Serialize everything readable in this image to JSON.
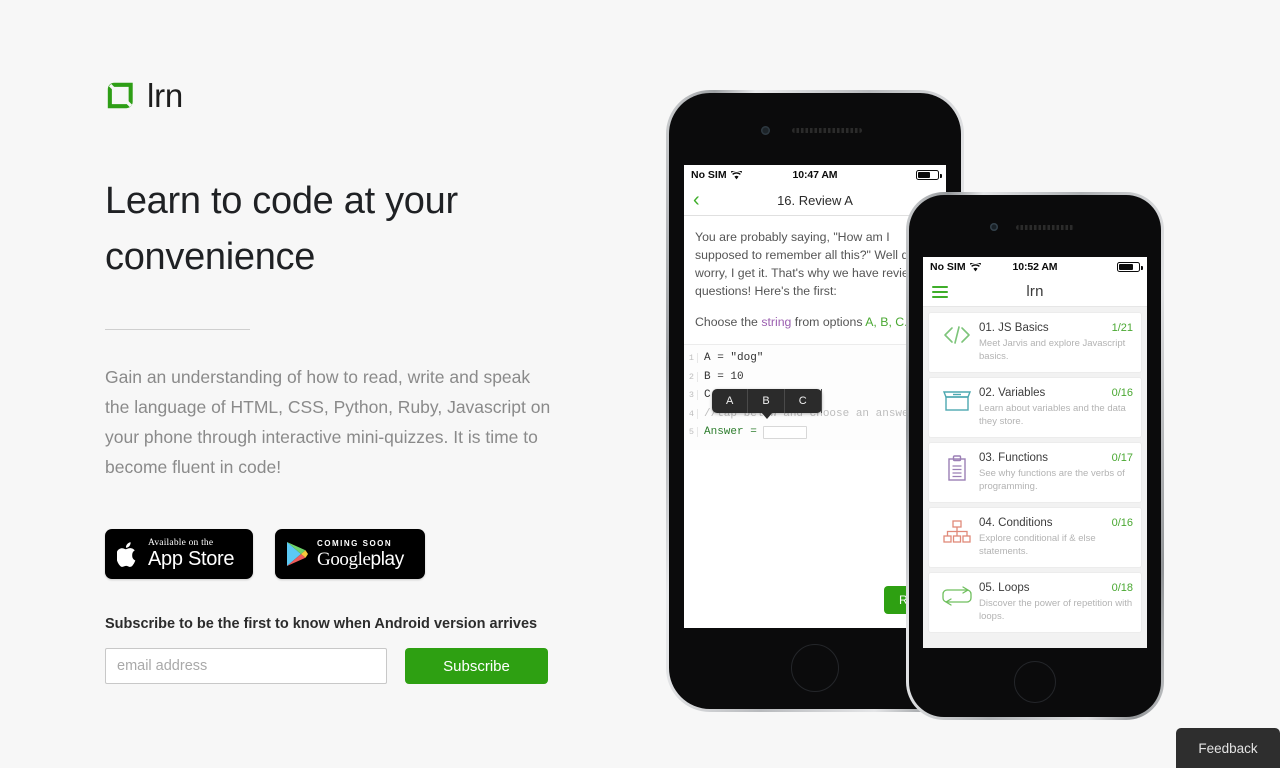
{
  "brand": {
    "name": "lrn",
    "logo_color": "#2e9e16"
  },
  "hero": {
    "headline": "Learn to code at your convenience",
    "lede": "Gain an understanding of how to read, write and speak the language of HTML, CSS, Python, Ruby, Javascript on your phone through interactive mini-quizzes. It is time to become fluent in code!"
  },
  "badges": {
    "apple": {
      "small": "Available on the",
      "big": "App Store"
    },
    "google": {
      "top": "COMING SOON",
      "main_bold": "Google",
      "main_light": "play"
    }
  },
  "subscribe": {
    "label": "Subscribe to be the first to know when Android version arrives",
    "email_placeholder": "email address",
    "email_value": "",
    "button_label": "Subscribe"
  },
  "accent_color": "#2ea012",
  "feedback": {
    "label": "Feedback"
  },
  "phone_lesson": {
    "status": {
      "carrier": "No SIM",
      "time": "10:47 AM"
    },
    "nav": {
      "title": "16. Review A",
      "back_glyph": "‹"
    },
    "paragraph1": "You are probably saying, \"How am I supposed to remember all this?\" Well don't worry, I get it. That's why we have review questions! Here's the first:",
    "paragraph2": {
      "pre": "Choose the ",
      "keyword": "string",
      "mid": " from options ",
      "options": "A, B, C."
    },
    "code": [
      {
        "num": "1",
        "text": "A = \"dog\""
      },
      {
        "num": "2",
        "text": "B = 10"
      },
      {
        "num": "3",
        "text": "C = [1, 2]"
      },
      {
        "num": "4",
        "text": "//tap below and choose an answer"
      },
      {
        "num": "5",
        "text": "Answer = "
      }
    ],
    "tooltip_options": [
      "A",
      "B",
      "C"
    ],
    "run_button": "Run"
  },
  "phone_courses": {
    "status": {
      "carrier": "No SIM",
      "time": "10:52 AM"
    },
    "nav": {
      "title": "lrn"
    },
    "items": [
      {
        "title": "01. JS Basics",
        "count": "1/21",
        "desc": "Meet Jarvis and explore Javascript basics.",
        "icon": "code-brackets-icon",
        "icon_color": "#7dc47a"
      },
      {
        "title": "02. Variables",
        "count": "0/16",
        "desc": "Learn about variables and the data they store.",
        "icon": "box-icon",
        "icon_color": "#4da8b0"
      },
      {
        "title": "03. Functions",
        "count": "0/17",
        "desc": "See why functions are the verbs of programming.",
        "icon": "clipboard-icon",
        "icon_color": "#9b7fb5"
      },
      {
        "title": "04. Conditions",
        "count": "0/16",
        "desc": "Explore conditional if & else statements.",
        "icon": "tree-hierarchy-icon",
        "icon_color": "#e08a7a"
      },
      {
        "title": "05. Loops",
        "count": "0/18",
        "desc": "Discover the power of repetition with loops.",
        "icon": "loop-arrows-icon",
        "icon_color": "#6fbf5e"
      }
    ]
  }
}
